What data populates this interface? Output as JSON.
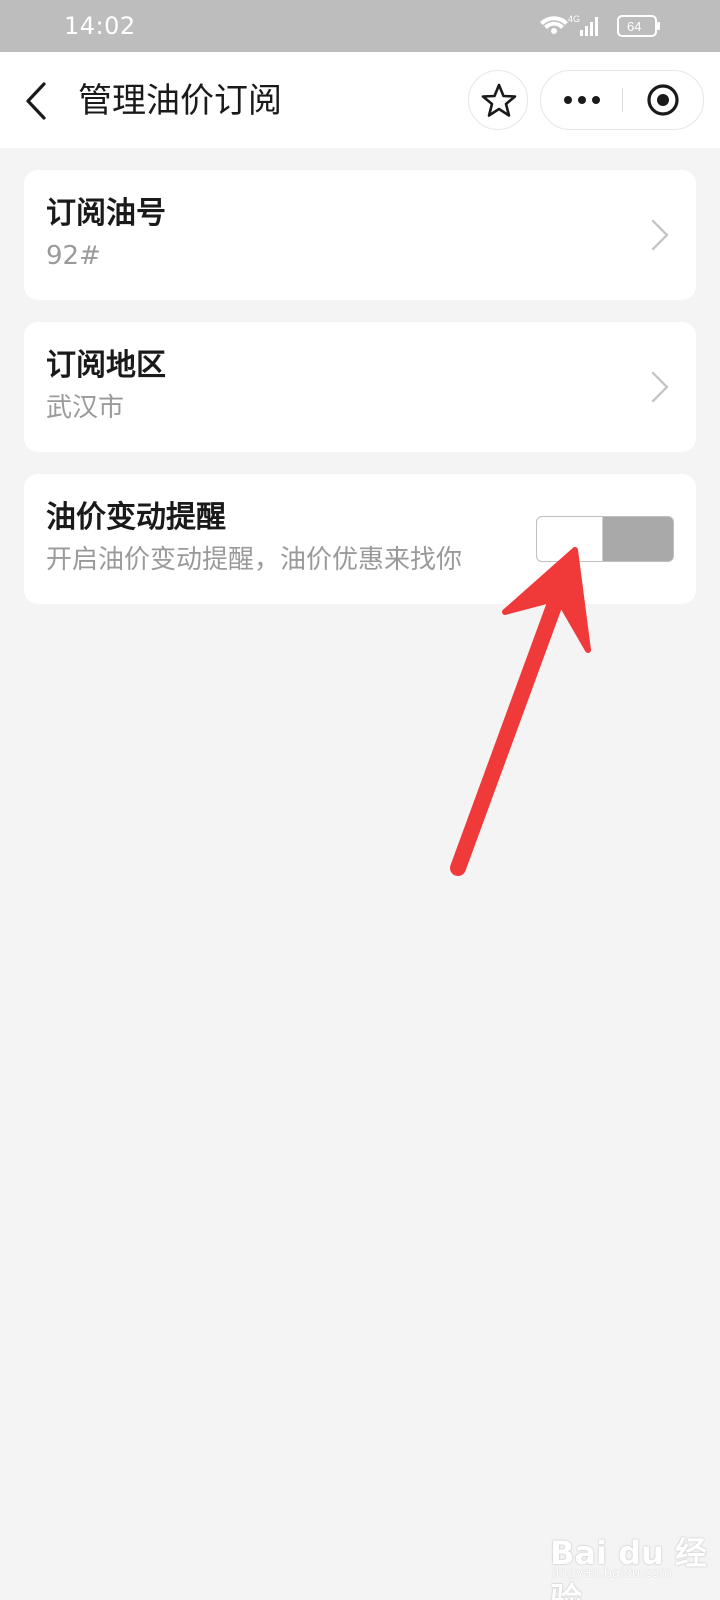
{
  "status_bar": {
    "time": "14:02",
    "network": "4G",
    "battery": "64",
    "icons": [
      "wifi-icon",
      "signal-icon",
      "battery-icon"
    ]
  },
  "nav": {
    "title": "管理油价订阅",
    "icons": [
      "back-arrow-icon",
      "star-icon",
      "more-dots-icon",
      "close-circle-icon"
    ]
  },
  "cards": [
    {
      "title": "订阅油号",
      "subtitle": "92#"
    },
    {
      "title": "订阅地区",
      "subtitle": "武汉市"
    },
    {
      "title": "油价变动提醒",
      "subtitle": "开启油价变动提醒，油价优惠来找你",
      "toggle_on": false
    }
  ],
  "watermark": {
    "text": "Bai du 经验",
    "sub": "jingyan.baidu.com"
  },
  "colors": {
    "status_bar_bg": "#bdbdbd",
    "page_bg": "#f4f4f4",
    "card_bg": "#ffffff",
    "toggle_off": "#a9a9a9",
    "annotation_arrow": "#f03a3a"
  }
}
